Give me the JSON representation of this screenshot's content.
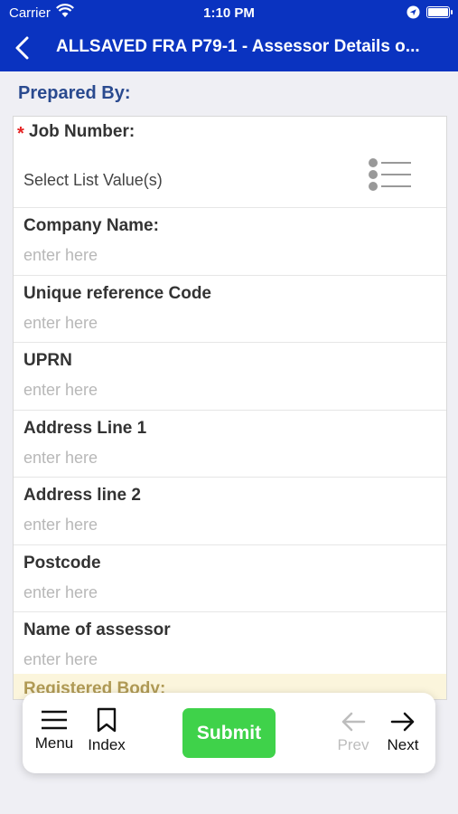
{
  "status": {
    "carrier": "Carrier",
    "time": "1:10 PM"
  },
  "nav": {
    "title": "ALLSAVED FRA P79-1 - Assessor Details o..."
  },
  "section": {
    "title": "Prepared By:"
  },
  "job": {
    "required_marker": "*",
    "label": "Job Number:",
    "value": "Select List Value(s)"
  },
  "fields": [
    {
      "label": "Company Name:",
      "placeholder": "enter here"
    },
    {
      "label": "Unique reference Code",
      "placeholder": "enter here"
    },
    {
      "label": "UPRN",
      "placeholder": "enter here"
    },
    {
      "label": "Address Line 1",
      "placeholder": "enter here"
    },
    {
      "label": "Address line 2",
      "placeholder": "enter here"
    },
    {
      "label": "Postcode",
      "placeholder": "enter here"
    },
    {
      "label": "Name of assessor",
      "placeholder": "enter here"
    }
  ],
  "next_section": {
    "title": "Registered Body:"
  },
  "toolbar": {
    "menu": "Menu",
    "index": "Index",
    "submit": "Submit",
    "prev": "Prev",
    "next": "Next"
  },
  "colors": {
    "header": "#0a33c0",
    "submit": "#3fd24a",
    "required": "#e52222"
  }
}
